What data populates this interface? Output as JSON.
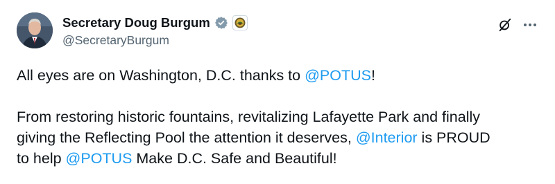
{
  "author": {
    "display_name": "Secretary Doug Burgum",
    "handle": "@SecretaryBurgum",
    "verified_badge_color": "#829aab"
  },
  "tweet": {
    "p1": {
      "t1": "All eyes are on Washington, D.C. thanks to ",
      "m1": "@POTUS",
      "t2": "!"
    },
    "p2": {
      "line1": "From restoring historic fountains, revitalizing Lafayette Park and finally",
      "line2_text": "giving the Reflecting Pool the attention it deserves, ",
      "line2_mention": "@Interior",
      "line2_tail": " is PROUD",
      "line3_text": "to help ",
      "line3_mention": "@POTUS",
      "line3_tail": " Make D.C. Safe and Beautiful!"
    }
  },
  "icons": {
    "verify": "verified-badge-icon",
    "affiliation": "interior-seal-icon",
    "grok": "grok-icon",
    "more": "more-icon"
  },
  "colors": {
    "link": "#1d9bf0",
    "text": "#0f1419",
    "secondary": "#536471"
  }
}
